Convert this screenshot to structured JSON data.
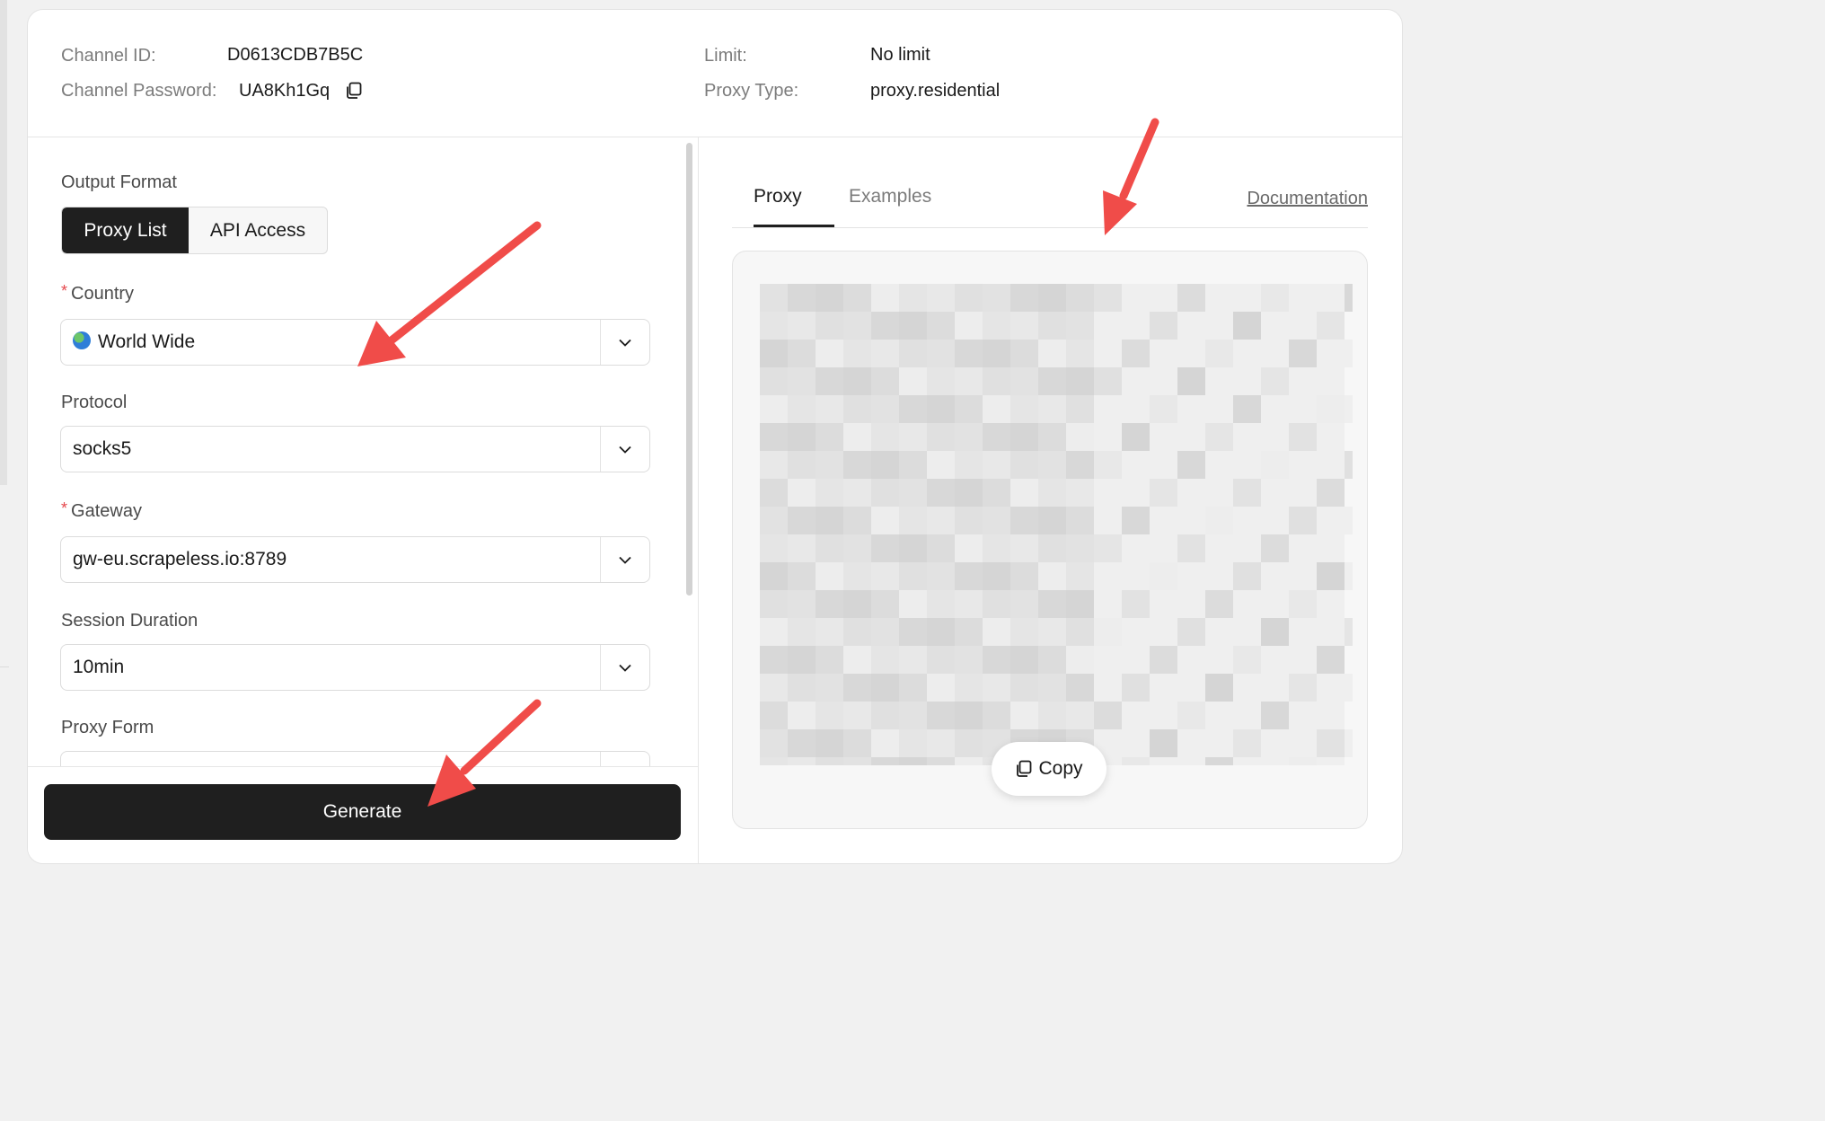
{
  "info": {
    "channel_id_label": "Channel ID:",
    "channel_id_value": "D0613CDB7B5C",
    "channel_password_label": "Channel Password:",
    "channel_password_value": "UA8Kh1Gq",
    "limit_label": "Limit:",
    "limit_value": "No limit",
    "proxy_type_label": "Proxy Type:",
    "proxy_type_value": "proxy.residential"
  },
  "form": {
    "output_format_label": "Output Format",
    "output_format_options": [
      "Proxy List",
      "API Access"
    ],
    "country_label": "Country",
    "country_value": "World Wide",
    "protocol_label": "Protocol",
    "protocol_value": "socks5",
    "gateway_label": "Gateway",
    "gateway_value": "gw-eu.scrapeless.io:8789",
    "session_duration_label": "Session Duration",
    "session_duration_value": "10min",
    "proxy_form_label": "Proxy Form",
    "required_mark": "*",
    "generate_label": "Generate"
  },
  "output": {
    "tabs": [
      "Proxy",
      "Examples"
    ],
    "documentation_label": "Documentation",
    "copy_label": "Copy"
  },
  "colors": {
    "annotation_arrow": "#f04c49",
    "primary_button": "#1f1f1f",
    "required": "#e5484d"
  }
}
